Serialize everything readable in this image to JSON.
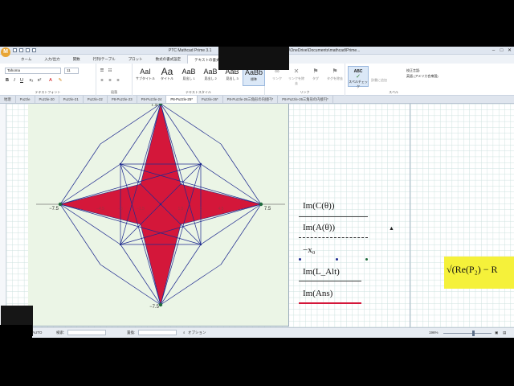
{
  "window": {
    "logo": "M",
    "title": "PTC Mathcad Prime 3.1",
    "path": "\\OneDrive\\Documents\\mathcad\\Prime..."
  },
  "ribbon_tabs": [
    "ホーム",
    "入力/出力",
    "関数",
    "行列/テーブル",
    "プロット",
    "数式の書式設定",
    "テキストの書式設定"
  ],
  "active_ribbon_tab": "テキストの書式設定",
  "ribbon": {
    "font_name": "Tahoma",
    "font_size": "11",
    "font_group_label": "テキストフォント",
    "paragraph_group_label": "段落",
    "styles": [
      {
        "sample": "AaI",
        "label": "サブタイトル"
      },
      {
        "sample": "Aa",
        "label": "タイトル"
      },
      {
        "sample": "AaB",
        "label": "見出し 1"
      },
      {
        "sample": "AaB",
        "label": "見出し 2"
      },
      {
        "sample": "AaB",
        "label": "見出し 3"
      },
      {
        "sample": "AaBb",
        "label": "標準"
      }
    ],
    "styles_group_label": "テキストスタイル",
    "link_buttons": [
      {
        "icon": "∞",
        "label": "リンク"
      },
      {
        "icon": "✕",
        "label": "リンクを除去"
      },
      {
        "icon": "⚑",
        "label": "タグ"
      },
      {
        "icon": "⚑",
        "label": "タグを除去"
      }
    ],
    "link_group_label": "リンク",
    "spell_button_top": "ABC",
    "spell_button_label": "スペルチェック",
    "spell_add_label": "辞書に追加",
    "language_label": "校正言語:",
    "language_value": "英語 (アメリカ合衆国)",
    "spell_group_label": "スペル"
  },
  "doc_tabs": [
    "地理",
    "Puzzle",
    "Puzzle-20",
    "Puzzle-21",
    "Puzzle-22",
    "P8-Puzzle-23",
    "P8-Puzzle-24",
    "P8-Puzzle-25*",
    "Puzzle-26*",
    "P8-Puzzle-26三角形の内接円*",
    "P8-Puzzle-26三角形の内接円*"
  ],
  "active_doc_tab": 7,
  "plot": {
    "x_min_label": "−7.5",
    "x_max_label": "7.5",
    "y_max_label": "7.5",
    "y_min_label": "−7.5",
    "inner_ticks": [
      "−4.5",
      "−3",
      "−1.5",
      "1.5",
      "3",
      "4.5"
    ]
  },
  "chart_data": {
    "type": "scatter",
    "xlim": [
      -7.5,
      7.5
    ],
    "ylim": [
      -7.5,
      7.5
    ],
    "star_polygon": [
      [
        0,
        7.5
      ],
      [
        1.5,
        1.5
      ],
      [
        7.5,
        0
      ],
      [
        1.5,
        -1.5
      ],
      [
        0,
        -7.5
      ],
      [
        -1.5,
        -1.5
      ],
      [
        -7.5,
        0
      ],
      [
        -1.5,
        1.5
      ]
    ],
    "outer_points": [
      [
        0,
        7.5
      ],
      [
        7.5,
        0
      ],
      [
        0,
        -7.5
      ],
      [
        -7.5,
        0
      ]
    ],
    "square_corners": [
      [
        3,
        3
      ],
      [
        3,
        -3
      ],
      [
        -3,
        -3
      ],
      [
        -3,
        3
      ]
    ],
    "fill_color": "#d4173a",
    "line_color": "#1e2a8f",
    "point_color": "#1f6b3c"
  },
  "expressions": [
    {
      "text": "Im(C(θ))",
      "underline": "#333333"
    },
    {
      "text": "Im(A(θ))",
      "underline": "#333333"
    },
    {
      "text": "−x₀",
      "underline": ""
    },
    {
      "text": "Im(L_Alt)",
      "underline": "#333333"
    },
    {
      "text": "Im(Ans)",
      "underline": "#d4173a"
    }
  ],
  "sqrt_expr": "√(Re(P₂) − R",
  "status": {
    "left": "AUTO",
    "find_label": "検索:",
    "replace_label": "置換:",
    "options_label": "オプション",
    "zoom": "196%"
  }
}
